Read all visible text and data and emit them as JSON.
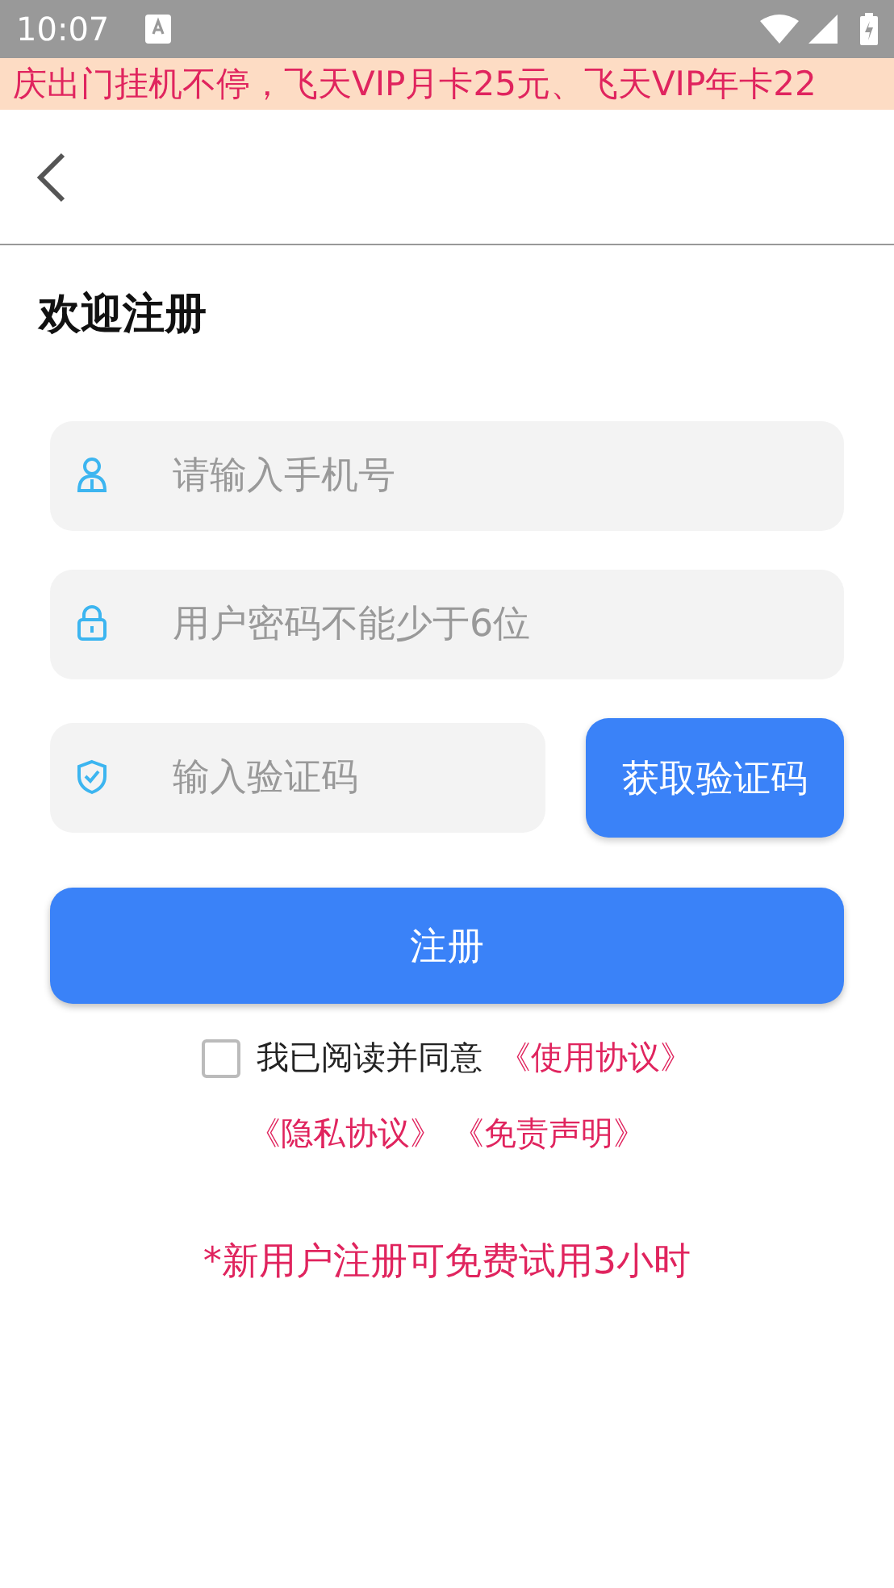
{
  "status_bar": {
    "time": "10:07"
  },
  "marquee": {
    "text": "庆出门挂机不停，飞天VIP月卡25元、飞天VIP年卡22"
  },
  "title": "欢迎注册",
  "fields": [
    {
      "kind": "person",
      "placeholder": "请输入手机号"
    },
    {
      "kind": "lock",
      "placeholder": "用户密码不能少于6位"
    },
    {
      "kind": "shield",
      "placeholder": "输入验证码"
    }
  ],
  "code_button": "获取验证码",
  "register_button": "注册",
  "agreement": {
    "checked": false,
    "text": "我已阅读并同意",
    "link": "《使用协议》"
  },
  "links": [
    "《隐私协议》",
    "《免责声明》"
  ],
  "note": "*新用户注册可免费试用3小时"
}
